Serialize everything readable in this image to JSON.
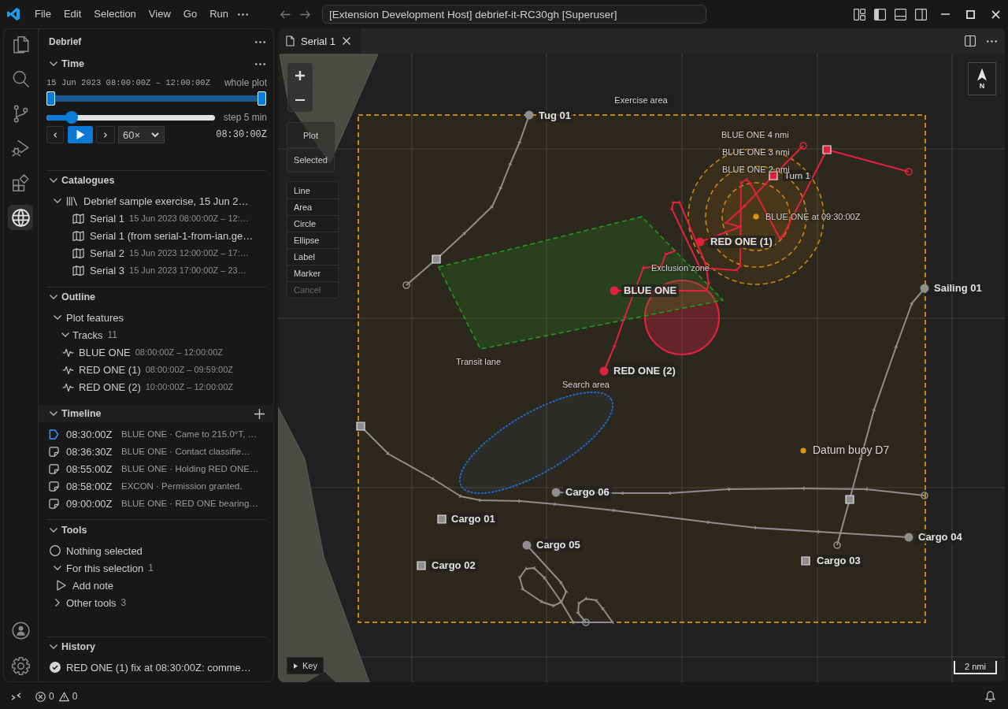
{
  "title_bar": {
    "menus": [
      "File",
      "Edit",
      "Selection",
      "View",
      "Go",
      "Run"
    ],
    "command_center": "[Extension Development Host] debrief-it-RC30gh [Superuser]"
  },
  "activity_bar": {
    "items": [
      {
        "kind": "explorer",
        "selected": false
      },
      {
        "kind": "search",
        "selected": false
      },
      {
        "kind": "source-control",
        "selected": false
      },
      {
        "kind": "run-debug",
        "selected": false
      },
      {
        "kind": "extensions",
        "selected": false
      },
      {
        "kind": "globe",
        "selected": true
      }
    ]
  },
  "sidebar": {
    "title": "Debrief",
    "time": {
      "heading": "Time",
      "expanded": true,
      "range_text": "15 Jun 2023 08:00:00Z – 12:00:00Z",
      "range_label": "whole plot",
      "range_handles": [
        {
          "level": 0
        },
        {
          "level": 1
        }
      ],
      "step_slider": {
        "level": 0.15
      },
      "step_label": "step 5 min",
      "speed": "60×",
      "clock": "08:30:00Z"
    },
    "catalogues": {
      "heading": "Catalogues",
      "expanded": true,
      "items": [
        {
          "label": "Debrief sample exercise, 15 Jun 2…",
          "expanded": true,
          "children": [
            {
              "label": "Serial 1",
              "detail": "15 Jun 2023 08:00:00Z – 12:…"
            },
            {
              "label": "Serial 1 (from serial-1-from-ian.ge…"
            },
            {
              "label": "Serial 2",
              "detail": "15 Jun 2023 12:00:00Z – 17:…"
            },
            {
              "label": "Serial 3",
              "detail": "15 Jun 2023 17:00:00Z – 23…"
            }
          ]
        }
      ]
    },
    "outline": {
      "heading": "Outline",
      "expanded": true,
      "items": [
        {
          "label": "Plot features",
          "expanded": true,
          "children": [
            {
              "label": "Tracks",
              "count": "11",
              "expanded": true,
              "children": [
                {
                  "label": "BLUE ONE",
                  "detail": "08:00:00Z – 12:00:00Z"
                },
                {
                  "label": "RED ONE (1)",
                  "detail": "08:00:00Z – 09:59:00Z"
                },
                {
                  "label": "RED ONE (2)",
                  "detail": "10:00:00Z – 12:00:00Z"
                }
              ]
            }
          ]
        }
      ]
    },
    "timeline": {
      "heading": "Timeline",
      "expanded": true,
      "entries": [
        {
          "time": "08:30:00Z",
          "text": "BLUE ONE · Came to 215.0°T, …",
          "current": true
        },
        {
          "time": "08:36:30Z",
          "text": "BLUE ONE · Contact classifie…",
          "current": false
        },
        {
          "time": "08:55:00Z",
          "text": "BLUE ONE · Holding RED ONE…",
          "current": false
        },
        {
          "time": "08:58:00Z",
          "text": "EXCON · Permission granted.",
          "current": false
        },
        {
          "time": "09:00:00Z",
          "text": "BLUE ONE · RED ONE bearing…",
          "current": false
        }
      ]
    },
    "tools": {
      "heading": "Tools",
      "expanded": true,
      "selection_status": "Nothing selected",
      "groups": [
        {
          "label": "For this selection",
          "count": "1",
          "expanded": true,
          "children": [
            {
              "label": "Add note"
            }
          ]
        },
        {
          "label": "Other tools",
          "count": "3",
          "expanded": false
        }
      ]
    },
    "history": {
      "heading": "History",
      "expanded": true,
      "entries": [
        {
          "text": "RED ONE (1) fix at 08:30:00Z: comme…",
          "done": true
        }
      ]
    }
  },
  "editor": {
    "tabs": [
      {
        "label": "Serial 1",
        "selected": true
      }
    ],
    "map": {
      "view_buttons": [
        "Plot",
        "Selected"
      ],
      "draw_tools": [
        {
          "label": "Line",
          "disabled": false
        },
        {
          "label": "Area",
          "disabled": false
        },
        {
          "label": "Circle",
          "disabled": false
        },
        {
          "label": "Ellipse",
          "disabled": false
        },
        {
          "label": "Label",
          "disabled": false
        },
        {
          "label": "Marker",
          "disabled": false
        },
        {
          "label": "Cancel",
          "disabled": true
        }
      ],
      "features": [
        {
          "kind": "rectangle",
          "label": "Exercise area",
          "color": "#c8860f"
        },
        {
          "kind": "track",
          "label": "Tug 01",
          "color": "#8e8e8e"
        },
        {
          "kind": "range-ring",
          "label": "BLUE ONE 4 nmi",
          "color": "#c8860f"
        },
        {
          "kind": "range-ring",
          "label": "BLUE ONE 3 nmi",
          "color": "#c8860f"
        },
        {
          "kind": "marker",
          "label": "Turn 1",
          "color": "#e0223f"
        },
        {
          "kind": "range-ring",
          "label": "BLUE ONE 2 nmi",
          "color": "#c8860f"
        },
        {
          "kind": "point",
          "label": "BLUE ONE at 09:30:00Z"
        },
        {
          "kind": "track",
          "label": "RED ONE (1)",
          "color": "#e0223f"
        },
        {
          "kind": "circle",
          "label": "Exclusion zone",
          "color": "#e0223f"
        },
        {
          "kind": "track",
          "label": "Sailing 01",
          "color": "#8e8e8e"
        },
        {
          "kind": "track",
          "label": "BLUE ONE",
          "color": "#e0223f"
        },
        {
          "kind": "polygon",
          "label": "Transit lane",
          "color": "#1e9a1e"
        },
        {
          "kind": "track",
          "label": "RED ONE (2)",
          "color": "#e0223f"
        },
        {
          "kind": "ellipse",
          "label": "Search area",
          "color": "#1a6fd8"
        },
        {
          "kind": "datum",
          "label": "Datum buoy D7",
          "color": "#e0940f"
        },
        {
          "kind": "track",
          "label": "Cargo 06",
          "color": "#8e8e8e"
        },
        {
          "kind": "track",
          "label": "Cargo 01",
          "color": "#8e8e8e"
        },
        {
          "kind": "track",
          "label": "Cargo 04",
          "color": "#8e8e8e"
        },
        {
          "kind": "track",
          "label": "Cargo 05",
          "color": "#8e8e8e"
        },
        {
          "kind": "track",
          "label": "Cargo 03",
          "color": "#8e8e8e"
        },
        {
          "kind": "track",
          "label": "Cargo 02",
          "color": "#8e8e8e"
        }
      ],
      "north_label": "N",
      "key_button": "Key",
      "scale_label": "2 nmi"
    }
  },
  "status_bar": {
    "errors": "0",
    "warnings": "0"
  }
}
